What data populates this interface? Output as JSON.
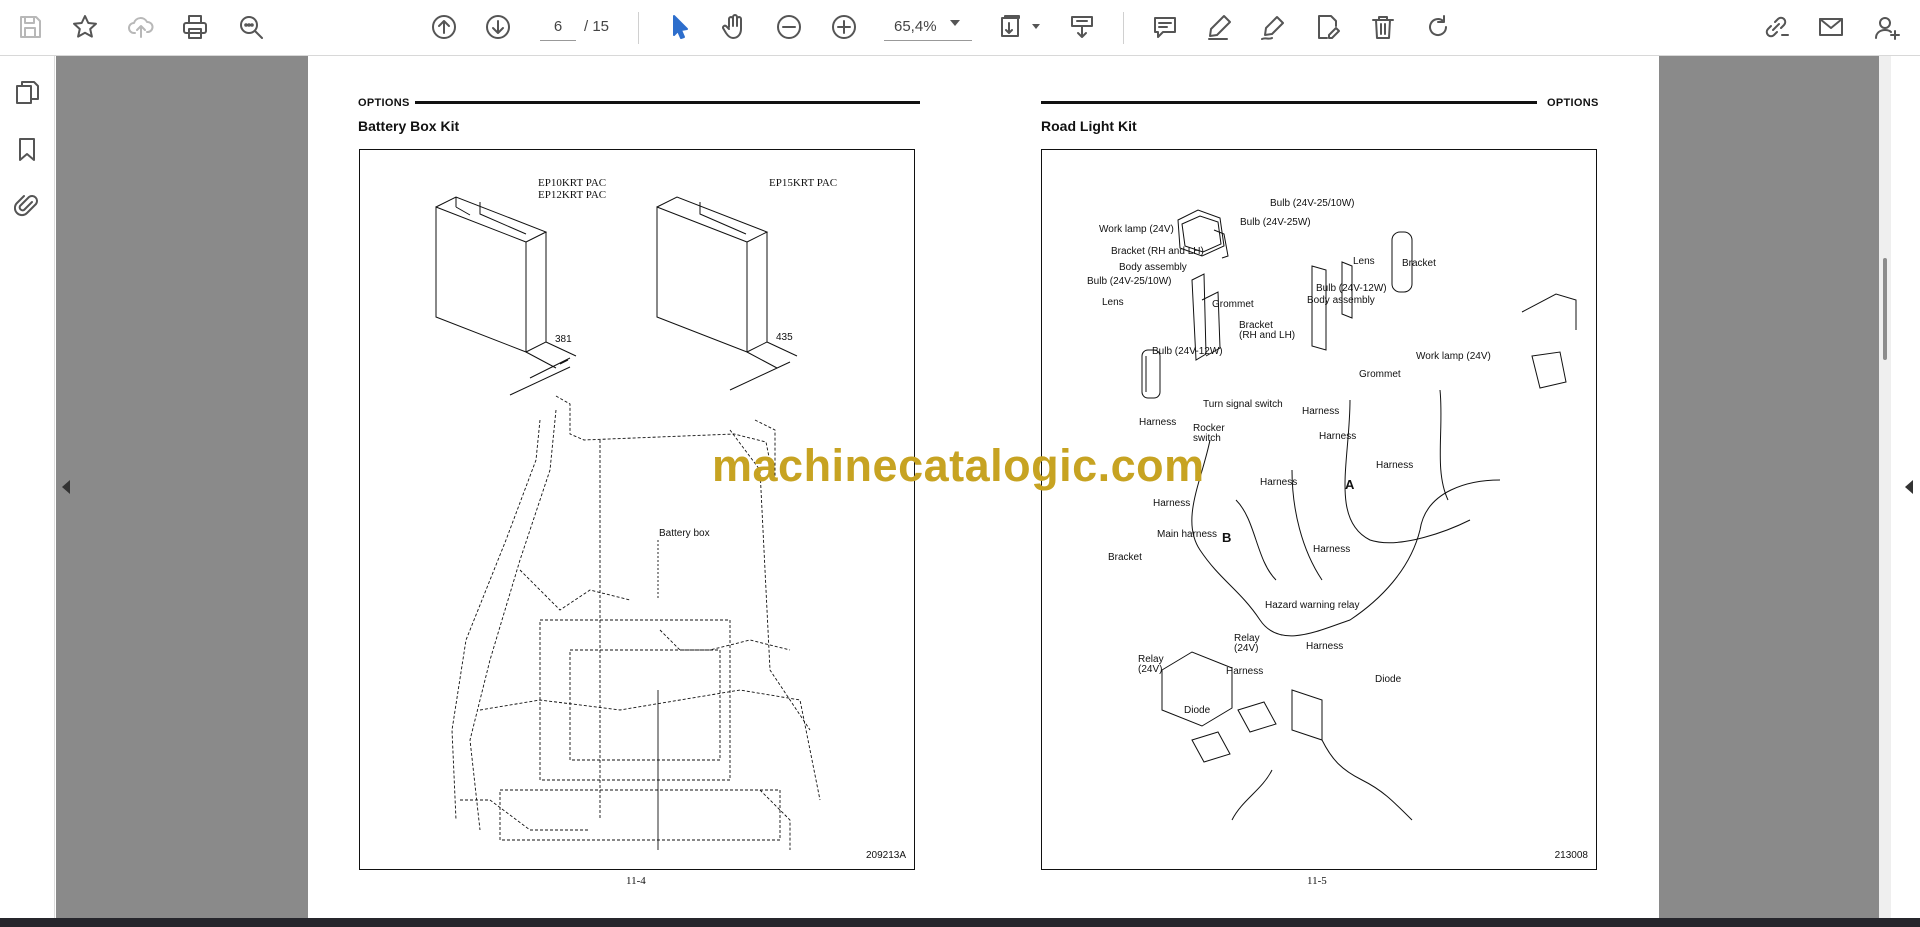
{
  "toolbar": {
    "icons": [
      "save-icon",
      "bookmark-star-icon",
      "upload-cloud-icon",
      "print-icon",
      "zoom-search-icon",
      "previous-page-icon",
      "next-page-icon",
      "select-cursor-icon",
      "hand-pan-icon",
      "zoom-out-icon",
      "zoom-in-icon",
      "fit-page-icon",
      "scroll-mode-icon",
      "comment-icon",
      "highlight-pen-icon",
      "draw-icon",
      "edit-document-icon",
      "delete-icon",
      "rotate-icon",
      "share-link-icon",
      "email-icon",
      "add-user-icon"
    ],
    "current_page": "6",
    "total_pages": "/ 15",
    "zoom": "65,4%"
  },
  "left_rail": {
    "icons": [
      "page-thumbnails-icon",
      "bookmarks-icon",
      "attachments-icon"
    ]
  },
  "left_page": {
    "header": "OPTIONS",
    "title": "Battery Box Kit",
    "labels": {
      "model_a": "EP10KRT PAC",
      "model_b": "EP12KRT PAC",
      "model_c": "EP15KRT PAC",
      "dim_a": "381",
      "dim_b": "435",
      "battery_box": "Battery box"
    },
    "figure_code": "209213A",
    "page_number": "11-4"
  },
  "right_page": {
    "header": "OPTIONS",
    "title": "Road Light Kit",
    "labels": {
      "work_lamp_left": "Work lamp (24V)",
      "bracket_rh_lh": "Bracket (RH and LH)",
      "body_assembly_left": "Body assembly",
      "bulb_25_10_left": "Bulb (24V-25/10W)",
      "lens_left": "Lens",
      "bulb_12_left": "Bulb (24V-12W)",
      "grommet_left": "Grommet",
      "bulb_25_10_top": "Bulb (24V-25/10W)",
      "bulb_25": "Bulb (24V-25W)",
      "lens_right": "Lens",
      "bulb_12_right": "Bulb (24V-12W)",
      "body_assembly_right": "Body assembly",
      "bracket_rh_lh_2a": "Bracket",
      "bracket_rh_lh_2b": "(RH and LH)",
      "bracket_top_right": "Bracket",
      "work_lamp_right": "Work lamp (24V)",
      "grommet_right": "Grommet",
      "turn_signal_switch": "Turn signal switch",
      "harness_1": "Harness",
      "rocker_switch_a": "Rocker",
      "rocker_switch_b": "switch",
      "harness_2": "Harness",
      "harness_3": "Harness",
      "harness_4": "Harness",
      "harness_5": "Harness",
      "harness_6": "Harness",
      "main_harness": "Main harness",
      "harness_7": "Harness",
      "point_a": "A",
      "point_b": "B",
      "bracket_bottom": "Bracket",
      "hazard_relay": "Hazard warning relay",
      "relay_a1": "Relay",
      "relay_a2": "(24V)",
      "relay_b1": "Relay",
      "relay_b2": "(24V)",
      "harness_8": "Harness",
      "harness_9": "Harness",
      "diode_1": "Diode",
      "diode_2": "Diode"
    },
    "figure_code": "213008",
    "page_number": "11-5"
  },
  "watermark": "machinecatalogic.com",
  "colors": {
    "canvas": "#8a8a8a",
    "accent": "#2d6ecc",
    "watermark": "#c7a322"
  }
}
